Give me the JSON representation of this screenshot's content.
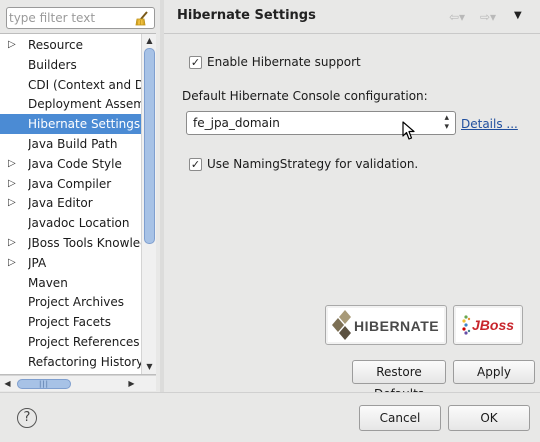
{
  "filter": {
    "placeholder": "type filter text"
  },
  "tree": {
    "items": [
      {
        "label": "Resource",
        "expandable": true
      },
      {
        "label": "Builders",
        "expandable": false
      },
      {
        "label": "CDI (Context and Dependency Injection)",
        "expandable": false
      },
      {
        "label": "Deployment Assembly",
        "expandable": false
      },
      {
        "label": "Hibernate Settings",
        "expandable": false,
        "selected": true
      },
      {
        "label": "Java Build Path",
        "expandable": false
      },
      {
        "label": "Java Code Style",
        "expandable": true
      },
      {
        "label": "Java Compiler",
        "expandable": true
      },
      {
        "label": "Java Editor",
        "expandable": true
      },
      {
        "label": "Javadoc Location",
        "expandable": false
      },
      {
        "label": "JBoss Tools Knowledge Base",
        "expandable": true
      },
      {
        "label": "JPA",
        "expandable": true
      },
      {
        "label": "Maven",
        "expandable": false
      },
      {
        "label": "Project Archives",
        "expandable": false
      },
      {
        "label": "Project Facets",
        "expandable": false
      },
      {
        "label": "Project References",
        "expandable": false
      },
      {
        "label": "Refactoring History",
        "expandable": false
      }
    ]
  },
  "page": {
    "title": "Hibernate Settings",
    "enable_label": "Enable Hibernate support",
    "enable_checked": true,
    "console_label": "Default Hibernate Console configuration:",
    "console_value": "fe_jpa_domain",
    "details_link": "Details ...",
    "naming_label": "Use NamingStrategy for validation.",
    "naming_checked": true,
    "hibernate_logo": "HIBERNATE",
    "jboss_logo": "JBoss"
  },
  "buttons": {
    "restore_defaults": "Restore Defaults",
    "apply": "Apply",
    "cancel": "Cancel",
    "ok": "OK"
  },
  "icons": {
    "help": "?",
    "check": "✓"
  },
  "colors": {
    "selection": "#4b8bd4",
    "link": "#1f4e9e",
    "jboss_red": "#c8252c"
  }
}
